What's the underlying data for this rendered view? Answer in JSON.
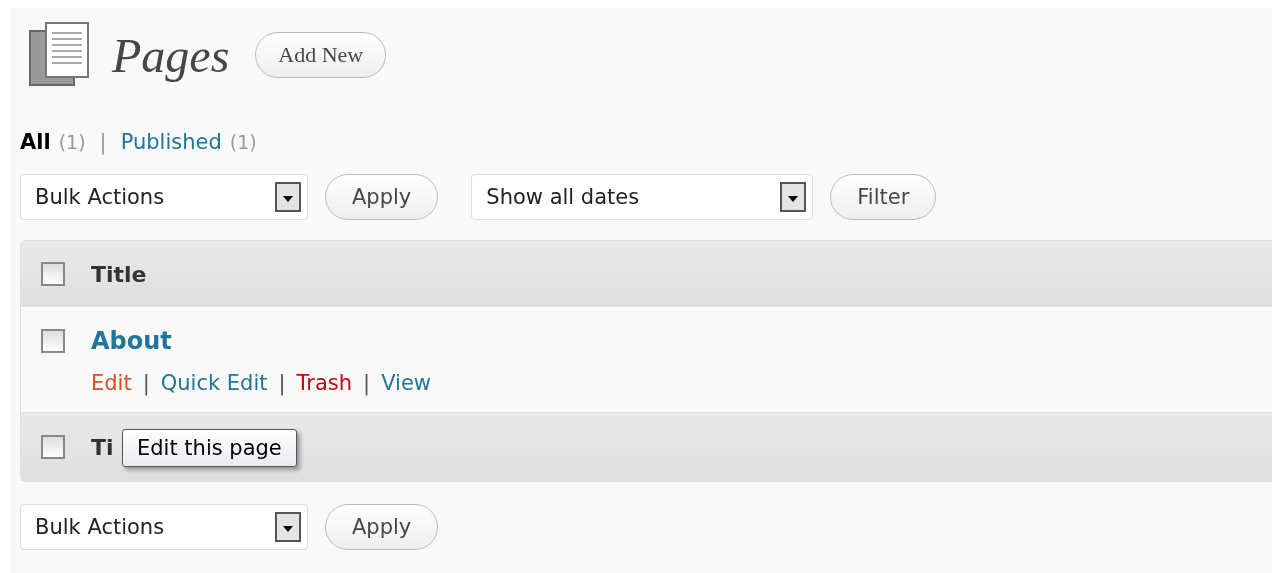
{
  "header": {
    "title": "Pages",
    "add_new": "Add New"
  },
  "filters": [
    {
      "label": "All",
      "count": "(1)",
      "selected": true
    },
    {
      "label": "Published",
      "count": "(1)",
      "selected": false,
      "separator": "|"
    }
  ],
  "top_actions": {
    "bulk": "Bulk Actions",
    "apply": "Apply",
    "dates": "Show all dates",
    "filter": "Filter"
  },
  "table": {
    "header": {
      "title": "Title",
      "checked": false
    },
    "rows": [
      {
        "title": "About",
        "checked": false,
        "actions": [
          {
            "label": "Edit",
            "kind": "edit"
          },
          {
            "label": "Quick Edit",
            "kind": "link",
            "separator": "|"
          },
          {
            "label": "Trash",
            "kind": "delete",
            "separator": "|"
          },
          {
            "label": "View",
            "kind": "link",
            "separator": "|"
          }
        ]
      }
    ],
    "footer": {
      "title": "Ti",
      "checked": false
    }
  },
  "tooltip": {
    "text": "Edit this page"
  },
  "bottom_actions": {
    "bulk": "Bulk Actions",
    "apply": "Apply"
  }
}
